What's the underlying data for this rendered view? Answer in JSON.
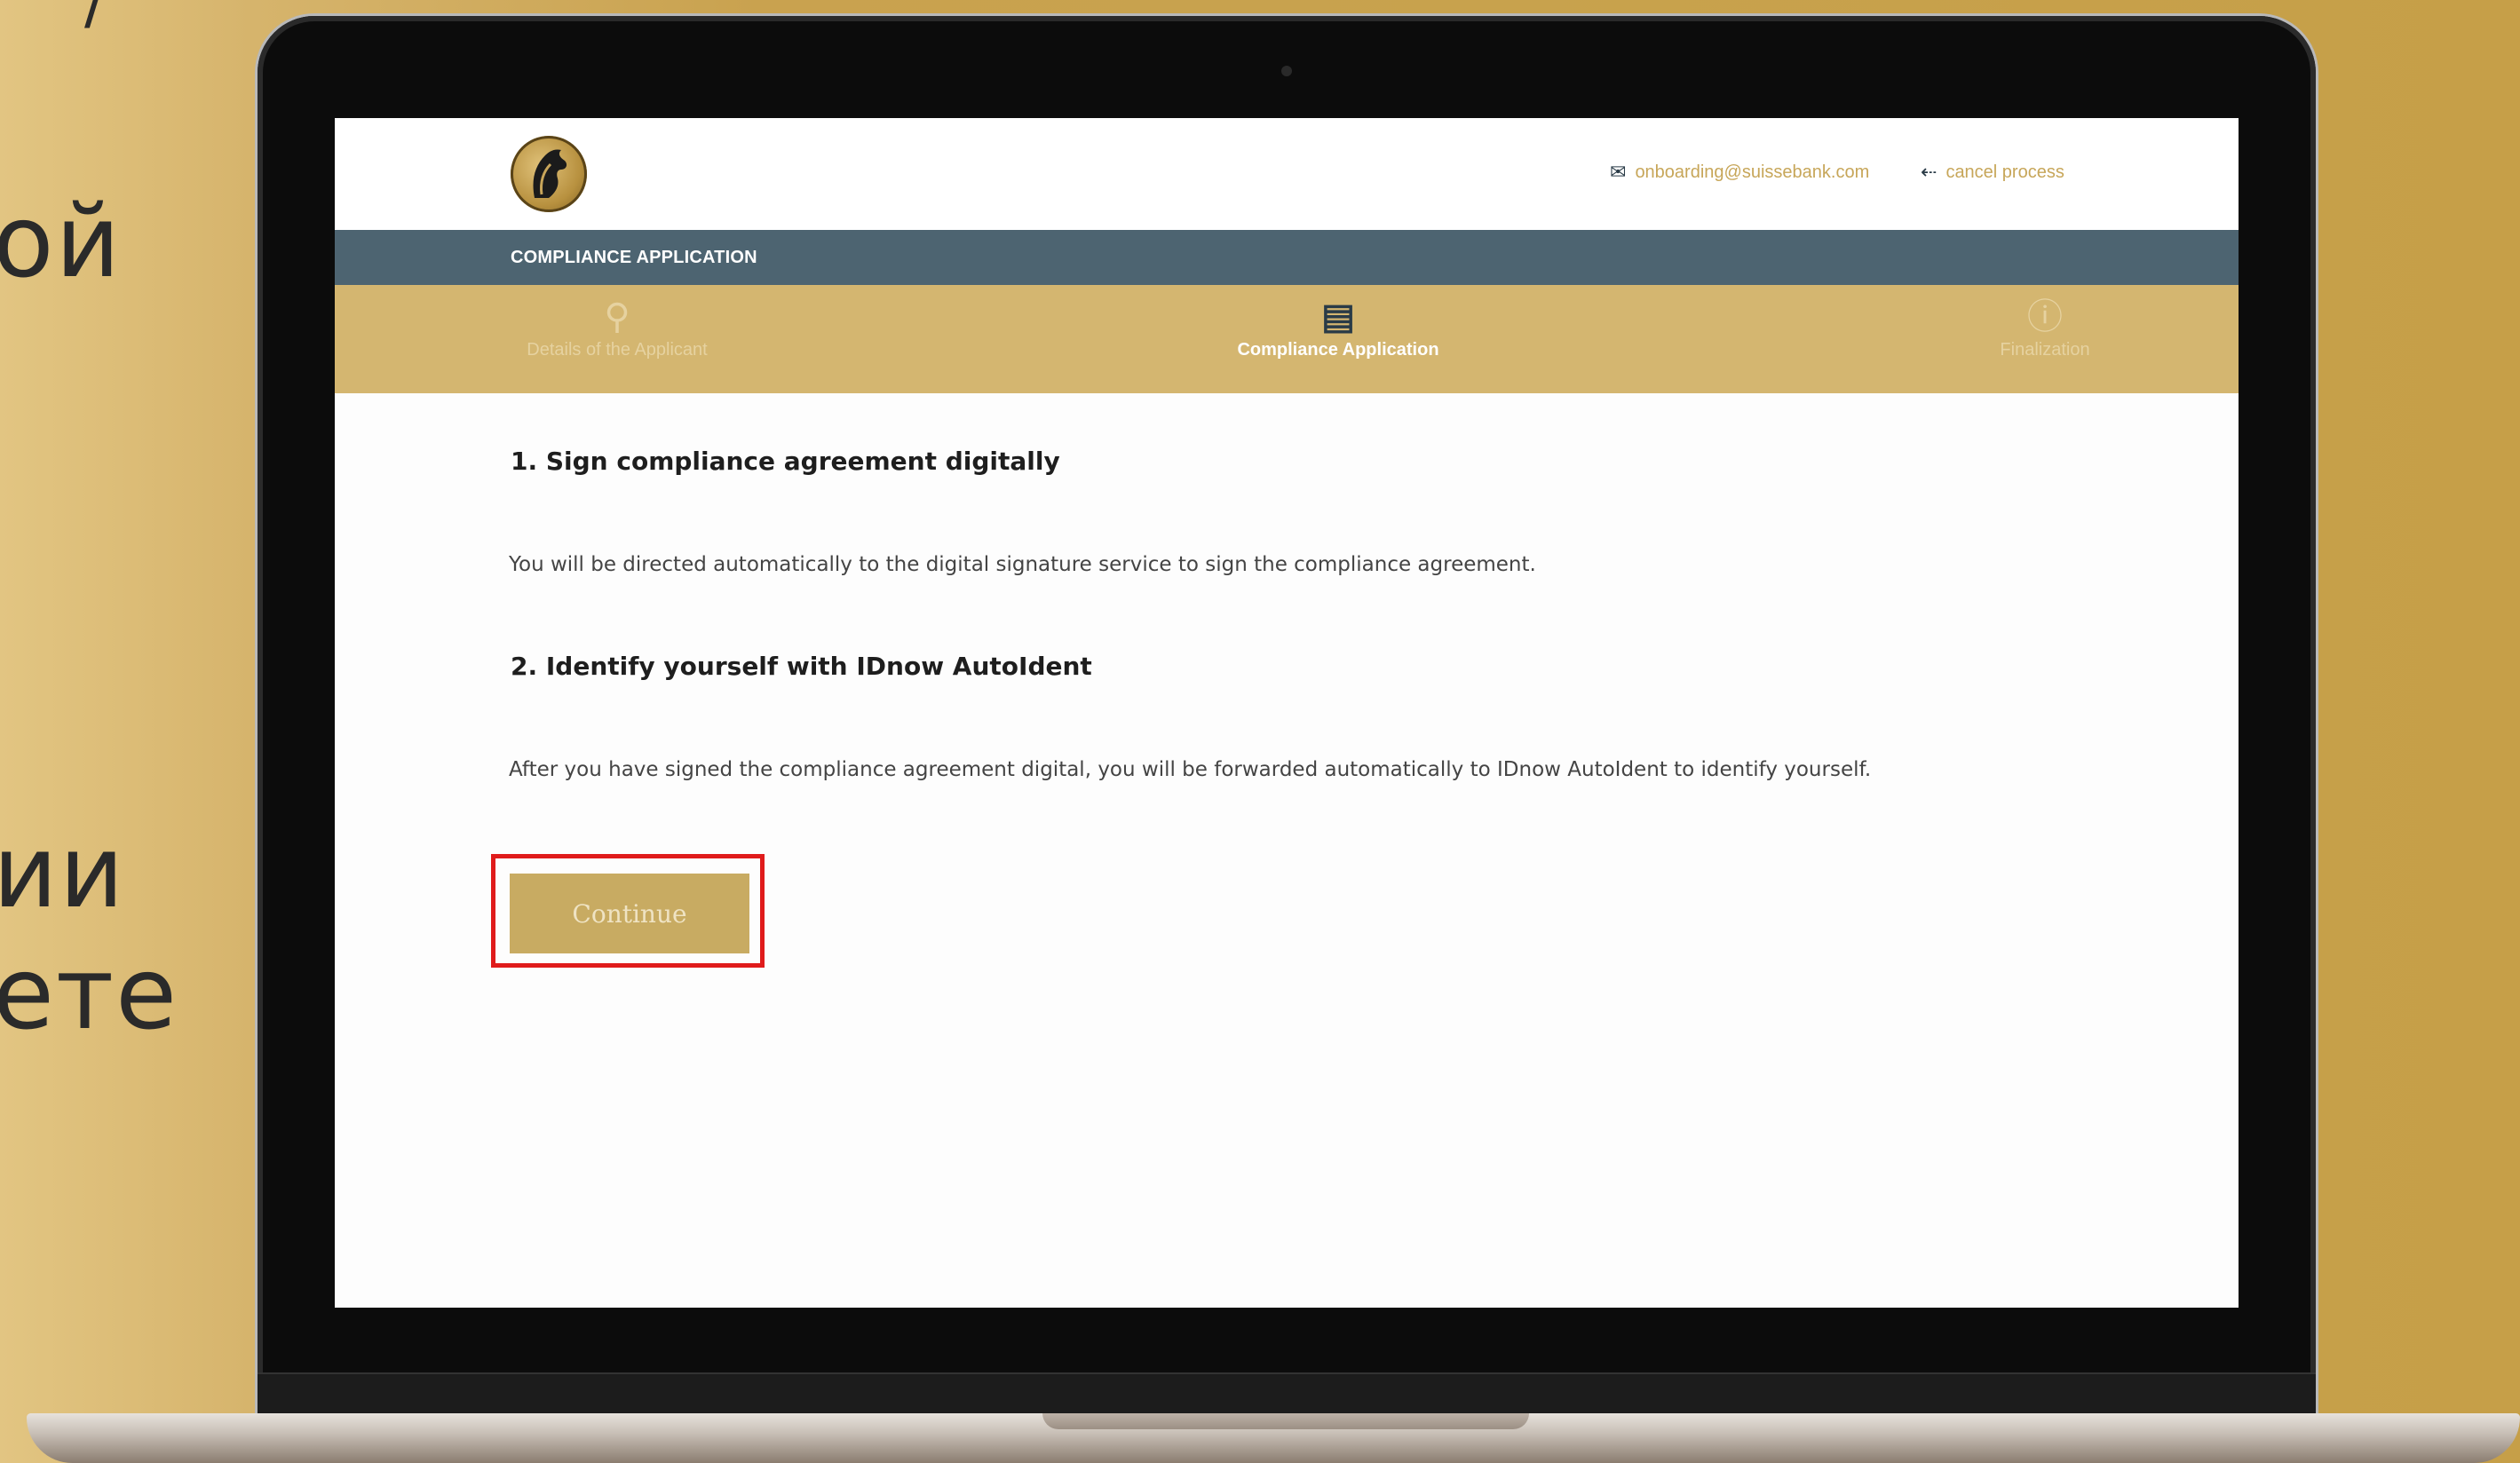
{
  "side_text": {
    "line1": "ой",
    "line2": "ии",
    "line3": "ете",
    "top_mark": "/"
  },
  "header": {
    "email": "onboarding@suissebank.com",
    "cancel": "cancel process",
    "section_title": "COMPLIANCE APPLICATION"
  },
  "steps": [
    {
      "label": "Details of the Applicant",
      "icon": "person-icon",
      "active": false
    },
    {
      "label": "Compliance Application",
      "icon": "document-icon",
      "active": true
    },
    {
      "label": "Finalization",
      "icon": "info-icon",
      "active": false
    }
  ],
  "content": {
    "step1_title": "1. Sign compliance agreement digitally",
    "step1_text": "You will be directed automatically to the digital signature service to sign the compliance agreement.",
    "step2_title": "2. Identify yourself with IDnow AutoIdent",
    "step2_text": "After you have signed the compliance agreement digital, you will be forwarded automatically to IDnow AutoIdent to identify yourself."
  },
  "button": {
    "continue_label": "Continue"
  },
  "colors": {
    "gold": "#d4b670",
    "slate": "#4d6471",
    "highlight": "#e01b1b"
  }
}
